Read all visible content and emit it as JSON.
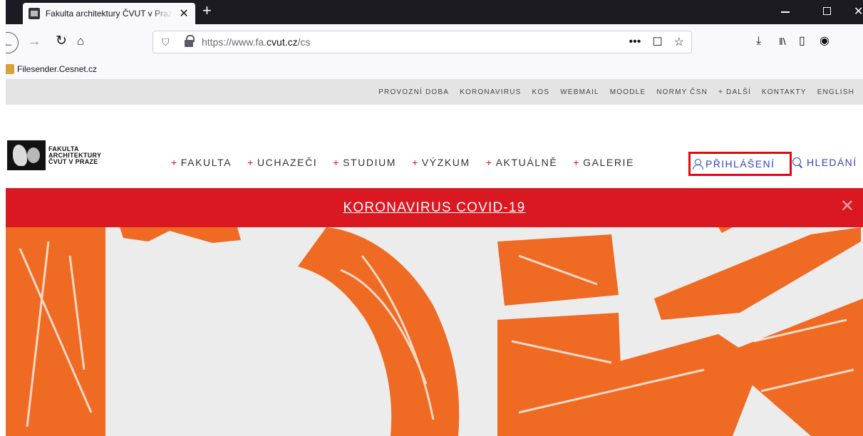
{
  "browser": {
    "tab_title": "Fakulta architektury ČVUT v Praze",
    "tab_close": "✕",
    "new_tab": "+",
    "url_prefix": "https://www.fa.",
    "url_domain": "cvut.cz",
    "url_suffix": "/cs",
    "page_actions": "•••",
    "bookmark_label": "Filesender.Cesnet.cz"
  },
  "utility_nav": [
    {
      "label": "PROVOZNÍ DOBA"
    },
    {
      "label": "KORONAVIRUS"
    },
    {
      "label": "KOS"
    },
    {
      "label": "WEBMAIL"
    },
    {
      "label": "MOODLE"
    },
    {
      "label": "NORMY ČSN"
    },
    {
      "label": "+ DALŠÍ"
    },
    {
      "label": "KONTAKTY"
    },
    {
      "label": "ENGLISH"
    }
  ],
  "logo": {
    "line1": "FAKULTA",
    "line2": "ARCHITEKTURY",
    "line3": "ČVUT V PRAZE"
  },
  "main_nav": [
    {
      "plus": "+",
      "label": "FAKULTA"
    },
    {
      "plus": "+",
      "label": "UCHAZEČI"
    },
    {
      "plus": "+",
      "label": "STUDIUM"
    },
    {
      "plus": "+",
      "label": "VÝZKUM"
    },
    {
      "plus": "+",
      "label": "AKTUÁLNĚ"
    },
    {
      "plus": "+",
      "label": "GALERIE"
    }
  ],
  "login_label": "PŘIHLÁŠENÍ",
  "search_label": "HLEDÁNÍ",
  "banner": {
    "link_text": "KORONAVIRUS COVID-19",
    "close": "✕"
  },
  "colors": {
    "brand_red": "#d91821",
    "link_blue": "#3344bb",
    "hero_orange": "#ef6a23"
  }
}
